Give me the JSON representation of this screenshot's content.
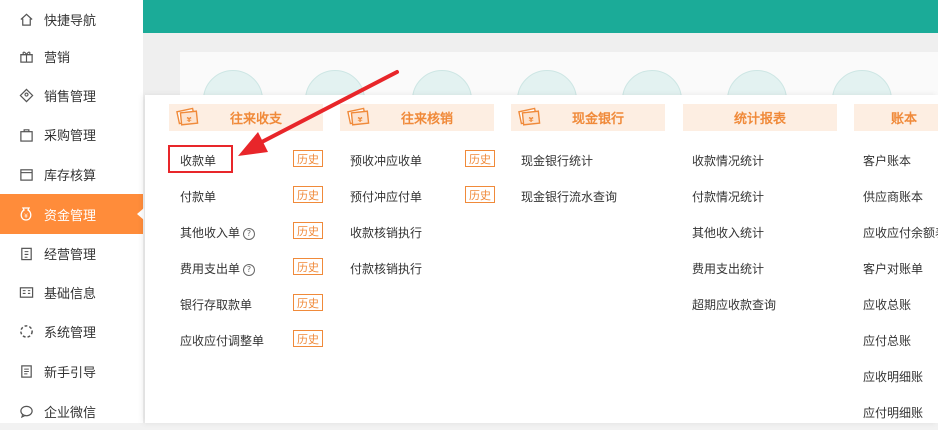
{
  "sidebar": {
    "items": [
      {
        "label": "快捷导航",
        "icon": "home-icon"
      },
      {
        "label": "营销",
        "icon": "gift-icon"
      },
      {
        "label": "销售管理",
        "icon": "tag-icon"
      },
      {
        "label": "采购管理",
        "icon": "bag-icon"
      },
      {
        "label": "库存核算",
        "icon": "box-icon"
      },
      {
        "label": "资金管理",
        "icon": "money-icon",
        "active": true
      },
      {
        "label": "经营管理",
        "icon": "clipboard-icon"
      },
      {
        "label": "基础信息",
        "icon": "id-card-icon"
      },
      {
        "label": "系统管理",
        "icon": "loading-icon"
      },
      {
        "label": "新手引导",
        "icon": "document-icon"
      },
      {
        "label": "企业微信",
        "icon": "chat-icon"
      }
    ]
  },
  "menu": {
    "columns": [
      {
        "title": "往来收支",
        "links": [
          "收款单",
          "付款单",
          "其他收入单",
          "费用支出单",
          "银行存取款单",
          "应收应付调整单"
        ],
        "history_label": "历史"
      },
      {
        "title": "往来核销",
        "links": [
          "预收冲应收单",
          "预付冲应付单",
          "收款核销执行",
          "付款核销执行"
        ],
        "history_label": "历史"
      },
      {
        "title": "现金银行",
        "links": [
          "现金银行统计",
          "现金银行流水查询"
        ]
      },
      {
        "title": "统计报表",
        "links": [
          "收款情况统计",
          "付款情况统计",
          "其他收入统计",
          "费用支出统计",
          "超期应收款查询"
        ]
      },
      {
        "title": "账本",
        "links": [
          "客户账本",
          "供应商账本",
          "应收应付余额表",
          "客户对账单",
          "应收总账",
          "应付总账",
          "应收明细账",
          "应付明细账"
        ]
      }
    ]
  },
  "colors": {
    "accent": "#ff8c3a",
    "topbar": "#1bab98",
    "highlight": "#e8262a"
  }
}
